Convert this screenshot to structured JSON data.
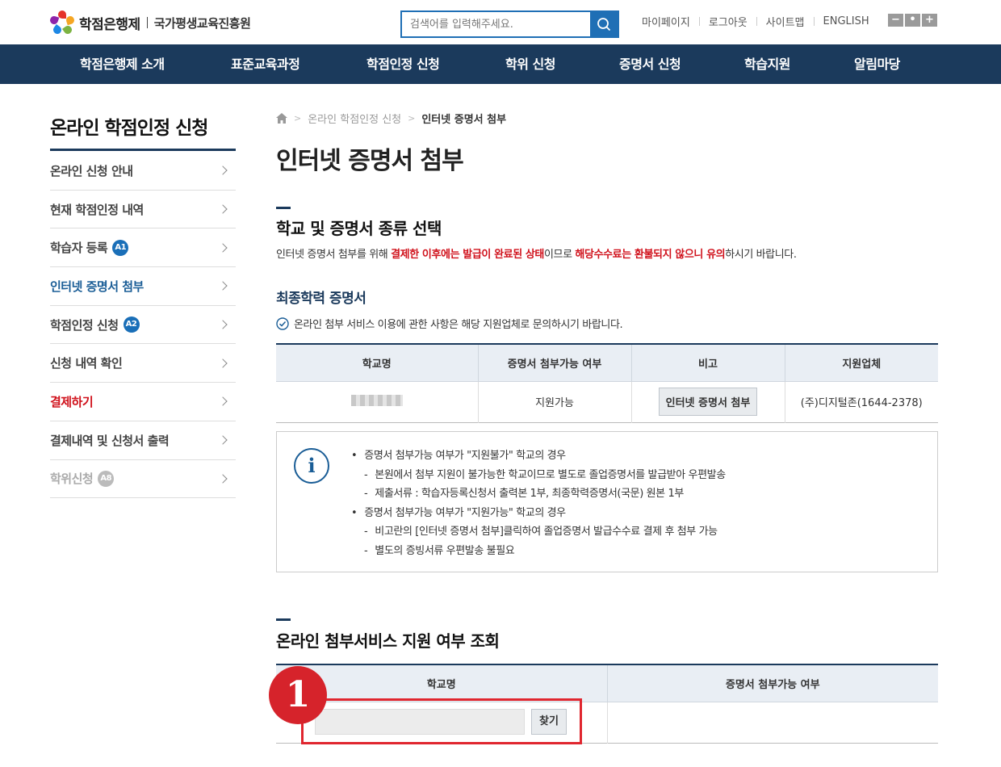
{
  "header": {
    "logo_title": "학점은행제",
    "logo_org": "국가평생교육진흥원",
    "search_placeholder": "검색어를 입력해주세요.",
    "util_links": [
      "마이페이지",
      "로그아웃",
      "사이트맵",
      "ENGLISH"
    ],
    "zoom": [
      "−",
      "•",
      "+"
    ]
  },
  "gnb": [
    "학점은행제 소개",
    "표준교육과정",
    "학점인정 신청",
    "학위 신청",
    "증명서 신청",
    "학습지원",
    "알림마당"
  ],
  "sidebar": {
    "title": "온라인 학점인정 신청",
    "items": [
      {
        "label": "온라인 신청 안내"
      },
      {
        "label": "현재 학점인정 내역"
      },
      {
        "label": "학습자 등록",
        "badge": "A1"
      },
      {
        "label": "인터넷 증명서 첨부"
      },
      {
        "label": "학점인정 신청",
        "badge": "A2"
      },
      {
        "label": "신청 내역 확인"
      },
      {
        "label": "결제하기"
      },
      {
        "label": "결제내역 및 신청서 출력"
      },
      {
        "label": "학위신청",
        "badge": "A8"
      }
    ]
  },
  "breadcrumb": [
    "온라인 학점인정 신청",
    "인터넷 증명서 첨부"
  ],
  "page_title": "인터넷 증명서 첨부",
  "section1": {
    "title": "학교 및 증명서 종류 선택",
    "notice_parts": [
      "인터넷 증명서 첨부를 위해 ",
      "결제한 이후에는 발급이 완료된 상태",
      "이므로 ",
      "해당수수료는 환불되지 않으니 유의",
      "하시기 바랍니다."
    ]
  },
  "subsection": {
    "title": "최종학력 증명서",
    "check_note": "온라인 첨부 서비스 이용에 관한 사항은 해당 지원업체로 문의하시기 바랍니다."
  },
  "table1": {
    "headers": [
      "학교명",
      "증명서 첨부가능 여부",
      "비고",
      "지원업체"
    ],
    "row": {
      "availability": "지원가능",
      "action": "인터넷 증명서 첨부",
      "vendor": "(주)디지털존(1644-2378)"
    }
  },
  "info": [
    {
      "type": "bullet",
      "text": "증명서 첨부가능 여부가 \"지원불가\" 학교의 경우"
    },
    {
      "type": "sub",
      "text": "본원에서 첨부 지원이 불가능한 학교이므로 별도로 졸업증명서를 발급받아 우편발송"
    },
    {
      "type": "sub",
      "text": "제출서류 : 학습자등록신청서 출력본 1부, 최종학력증명서(국문) 원본 1부"
    },
    {
      "type": "bullet",
      "text": "증명서 첨부가능 여부가 \"지원가능\" 학교의 경우"
    },
    {
      "type": "sub",
      "text": "비고란의 [인터넷 증명서 첨부]클릭하여 졸업증명서 발급수수료 결제 후 첨부 가능"
    },
    {
      "type": "sub",
      "text": "별도의 증빙서류 우편발송 불필요"
    }
  ],
  "section2": {
    "title": "온라인 첨부서비스 지원 여부 조회",
    "headers": [
      "학교명",
      "증명서 첨부가능 여부"
    ],
    "find_label": "찾기"
  },
  "annotation": {
    "number": "1"
  },
  "colors": {
    "navy": "#1b3a5c",
    "blue": "#1f6fb5",
    "red": "#d0111b"
  }
}
